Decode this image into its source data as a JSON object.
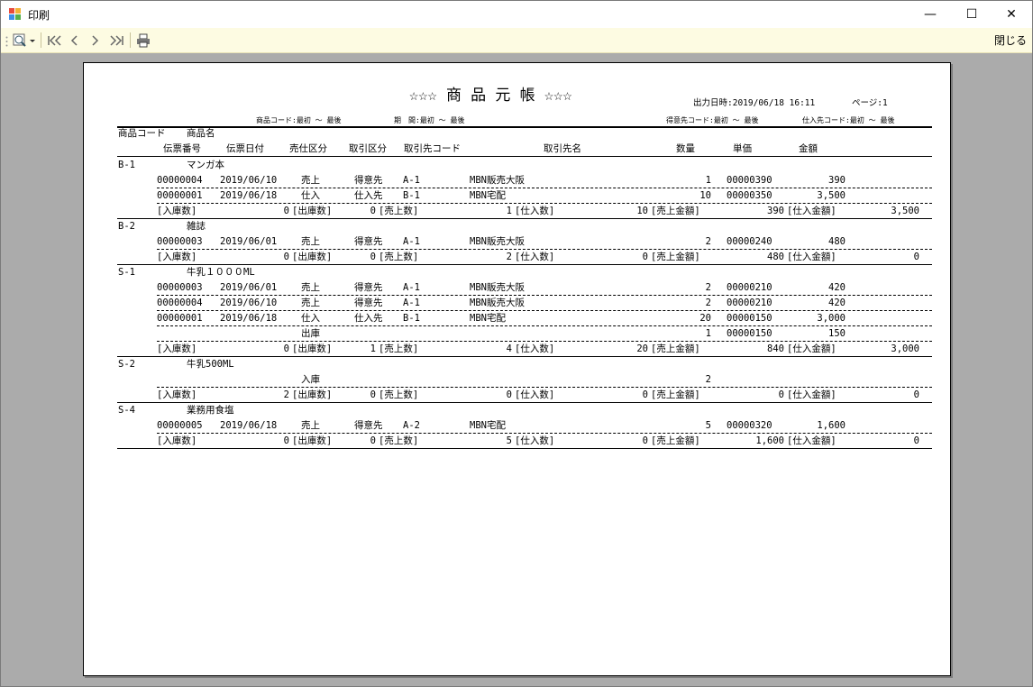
{
  "window": {
    "title": "印刷",
    "minimize": "—",
    "maximize": "☐",
    "close": "✕"
  },
  "toolbar": {
    "zoom_icon": "zoom-icon",
    "first": "I◁◁",
    "prev": "‹",
    "next": "›",
    "last": "▷▷I",
    "print_icon": "print-icon",
    "close_label": "閉じる"
  },
  "report": {
    "title": "☆☆☆ 商 品 元 帳 ☆☆☆",
    "output_datetime": "出力日時:2019/06/18 16:11",
    "page": "ページ:1",
    "cond_product": "商品コード:最初 ～ 最後",
    "cond_period": "期　間:最初 ～ 最後",
    "cond_customer": "得意先コード:最初 ～ 最後",
    "cond_supplier": "仕入先コード:最初 ～ 最後",
    "hdr_code": "商品コード",
    "hdr_name": "商品名",
    "hdr_slip_no": "伝票番号",
    "hdr_slip_date": "伝票日付",
    "hdr_sales_purchase": "売仕区分",
    "hdr_trade_type": "取引区分",
    "hdr_partner_code": "取引先コード",
    "hdr_partner_name": "取引先名",
    "hdr_qty": "数量",
    "hdr_unit_price": "単価",
    "hdr_amount": "金額",
    "lbl_in": "[入庫数]",
    "lbl_out": "[出庫数]",
    "lbl_sold": "[売上数]",
    "lbl_purchased": "[仕入数]",
    "lbl_sales_amt": "[売上金額]",
    "lbl_purch_amt": "[仕入金額]",
    "groups": [
      {
        "code": "B-1",
        "name": "マンガ本",
        "rows": [
          {
            "no": "00000004",
            "date": "2019/06/10",
            "kubun": "売上",
            "torihiki": "得意先",
            "pcode": "A-1",
            "pname": "MBN販売大阪",
            "qty": "1",
            "price": "00000390",
            "amount": "390"
          },
          {
            "no": "00000001",
            "date": "2019/06/18",
            "kubun": "仕入",
            "torihiki": "仕入先",
            "pcode": "B-1",
            "pname": "MBN宅配",
            "qty": "10",
            "price": "00000350",
            "amount": "3,500"
          }
        ],
        "sum": {
          "in": "0",
          "out": "0",
          "sold": "1",
          "purchased": "10",
          "sales_amt": "390",
          "purch_amt": "3,500"
        }
      },
      {
        "code": "B-2",
        "name": "雑誌",
        "rows": [
          {
            "no": "00000003",
            "date": "2019/06/01",
            "kubun": "売上",
            "torihiki": "得意先",
            "pcode": "A-1",
            "pname": "MBN販売大阪",
            "qty": "2",
            "price": "00000240",
            "amount": "480"
          }
        ],
        "sum": {
          "in": "0",
          "out": "0",
          "sold": "2",
          "purchased": "0",
          "sales_amt": "480",
          "purch_amt": "0"
        }
      },
      {
        "code": "S-1",
        "name": "牛乳１０００ML",
        "rows": [
          {
            "no": "00000003",
            "date": "2019/06/01",
            "kubun": "売上",
            "torihiki": "得意先",
            "pcode": "A-1",
            "pname": "MBN販売大阪",
            "qty": "2",
            "price": "00000210",
            "amount": "420"
          },
          {
            "no": "00000004",
            "date": "2019/06/10",
            "kubun": "売上",
            "torihiki": "得意先",
            "pcode": "A-1",
            "pname": "MBN販売大阪",
            "qty": "2",
            "price": "00000210",
            "amount": "420"
          },
          {
            "no": "00000001",
            "date": "2019/06/18",
            "kubun": "仕入",
            "torihiki": "仕入先",
            "pcode": "B-1",
            "pname": "MBN宅配",
            "qty": "20",
            "price": "00000150",
            "amount": "3,000"
          },
          {
            "no": "",
            "date": "",
            "kubun": "出庫",
            "torihiki": "",
            "pcode": "",
            "pname": "",
            "qty": "1",
            "price": "00000150",
            "amount": "150"
          }
        ],
        "sum": {
          "in": "0",
          "out": "1",
          "sold": "4",
          "purchased": "20",
          "sales_amt": "840",
          "purch_amt": "3,000"
        }
      },
      {
        "code": "S-2",
        "name": "牛乳500ML",
        "rows": [
          {
            "no": "",
            "date": "",
            "kubun": "入庫",
            "torihiki": "",
            "pcode": "",
            "pname": "",
            "qty": "2",
            "price": "",
            "amount": ""
          }
        ],
        "sum": {
          "in": "2",
          "out": "0",
          "sold": "0",
          "purchased": "0",
          "sales_amt": "0",
          "purch_amt": "0"
        }
      },
      {
        "code": "S-4",
        "name": "業務用食塩",
        "rows": [
          {
            "no": "00000005",
            "date": "2019/06/18",
            "kubun": "売上",
            "torihiki": "得意先",
            "pcode": "A-2",
            "pname": "MBN宅配",
            "qty": "5",
            "price": "00000320",
            "amount": "1,600"
          }
        ],
        "sum": {
          "in": "0",
          "out": "0",
          "sold": "5",
          "purchased": "0",
          "sales_amt": "1,600",
          "purch_amt": "0"
        }
      }
    ]
  }
}
